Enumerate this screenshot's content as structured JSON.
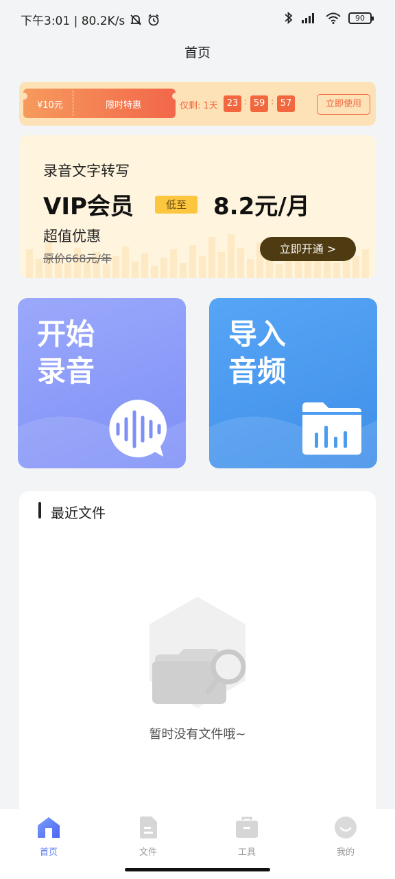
{
  "status_bar": {
    "time_speed": "下午3:01 | 80.2K/s",
    "battery": "90"
  },
  "header": {
    "title": "首页"
  },
  "promo": {
    "coupon_amount": "¥10元",
    "coupon_tag": "限时特惠",
    "remaining": "仅剩: 1天",
    "hours": "23",
    "minutes": "59",
    "seconds": "57",
    "colon": ":",
    "use_button": "立即使用"
  },
  "vip": {
    "subtitle": "录音文字转写",
    "title": "VIP会员",
    "badge": "低至",
    "price": "8.2元/月",
    "deal": "超值优惠",
    "original_price": "原价668元/年",
    "button": "立即开通 >"
  },
  "actions": {
    "record": {
      "line1": "开始",
      "line2": "录音",
      "icon": "voice-bubble-icon"
    },
    "import": {
      "line1": "导入",
      "line2": "音频",
      "icon": "audio-folder-icon"
    }
  },
  "recent": {
    "title": "最近文件",
    "empty_text": "暂时没有文件哦~"
  },
  "tabs": [
    {
      "label": "首页",
      "icon": "home-icon",
      "active": true
    },
    {
      "label": "文件",
      "icon": "file-icon",
      "active": false
    },
    {
      "label": "工具",
      "icon": "toolbox-icon",
      "active": false
    },
    {
      "label": "我的",
      "icon": "profile-icon",
      "active": false
    }
  ],
  "colors": {
    "accent": "#5b7cf5",
    "promo_orange": "#f0663f",
    "vip_button": "#4f3b12",
    "record_card": "#8a9bf8",
    "import_card": "#4a9cf0"
  }
}
